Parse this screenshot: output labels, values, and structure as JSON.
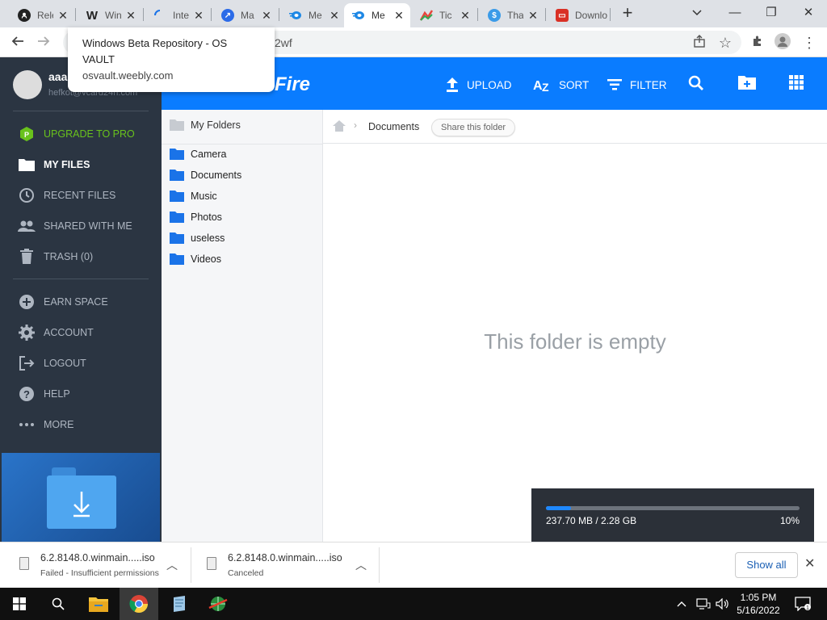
{
  "browser": {
    "tabs": [
      {
        "label": "Rele",
        "icon": "github-icon",
        "color": "#222222"
      },
      {
        "label": "Win",
        "icon": "weebly-icon",
        "color": "#222222"
      },
      {
        "label": "Inte",
        "icon": "loading-spinner-icon",
        "color": "#1a73e8"
      },
      {
        "label": "Ma",
        "icon": "compass-icon",
        "color": "#2b6be8"
      },
      {
        "label": "Me",
        "icon": "mediafire-icon",
        "color": "#1e88e5"
      },
      {
        "label": "Me",
        "icon": "mediafire-icon",
        "color": "#1e88e5"
      },
      {
        "label": "Tic",
        "icon": "chart-icon",
        "color": "#e8453c"
      },
      {
        "label": "Tha",
        "icon": "dollar-icon",
        "color": "#3b9be8"
      },
      {
        "label": "Downlo",
        "icon": "download-site-icon",
        "color": "#d93025"
      }
    ],
    "active_tab_index": 5,
    "url_fragment": "2wf",
    "tooltip": {
      "title": "Windows Beta Repository - OS VAULT",
      "url": "osvault.weebly.com"
    }
  },
  "app": {
    "brand": "Fire",
    "user": {
      "name": "aaa",
      "email": "hefkot@vcard24h.com"
    },
    "sidebar": {
      "upgrade": "UPGRADE TO PRO",
      "my_files": "MY FILES",
      "recent_files": "RECENT FILES",
      "shared_with_me": "SHARED WITH ME",
      "trash": "TRASH (0)",
      "earn_space": "EARN SPACE",
      "account": "ACCOUNT",
      "logout": "LOGOUT",
      "help": "HELP",
      "more": "MORE"
    },
    "header": {
      "upload": "UPLOAD",
      "sort": "SORT",
      "filter": "FILTER"
    },
    "folders": {
      "root": "My Folders",
      "items": [
        "Camera",
        "Documents",
        "Music",
        "Photos",
        "useless",
        "Videos"
      ]
    },
    "breadcrumb": {
      "current": "Documents",
      "share": "Share this folder"
    },
    "empty_message": "This folder is empty",
    "upload_progress": {
      "size_text": "237.70 MB / 2.28 GB",
      "percent_text": "10%",
      "fraction": 0.1
    }
  },
  "downloads": {
    "items": [
      {
        "name": "6.2.8148.0.winmain.....iso",
        "status": "Failed - Insufficient permissions"
      },
      {
        "name": "6.2.8148.0.winmain.....iso",
        "status": "Canceled"
      }
    ],
    "show_all": "Show all"
  },
  "taskbar": {
    "time": "1:05 PM",
    "date": "5/16/2022"
  },
  "colors": {
    "accent": "#0a7cff",
    "sidebar_bg": "#2b3542",
    "upgrade_green": "#69c21c",
    "folder_blue": "#1a73e8"
  }
}
